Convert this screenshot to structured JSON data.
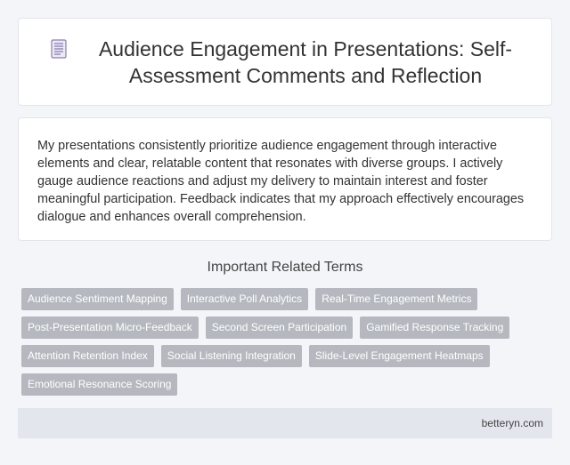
{
  "header": {
    "icon": "document-icon",
    "title": "Audience Engagement in Presentations: Self-Assessment Comments and Reflection"
  },
  "body": {
    "text": "My presentations consistently prioritize audience engagement through interactive elements and clear, relatable content that resonates with diverse groups. I actively gauge audience reactions and adjust my delivery to maintain interest and foster meaningful participation. Feedback indicates that my approach effectively encourages dialogue and enhances overall comprehension."
  },
  "terms": {
    "heading": "Important Related Terms",
    "items": [
      "Audience Sentiment Mapping",
      "Interactive Poll Analytics",
      "Real-Time Engagement Metrics",
      "Post-Presentation Micro-Feedback",
      "Second Screen Participation",
      "Gamified Response Tracking",
      "Attention Retention Index",
      "Social Listening Integration",
      "Slide-Level Engagement Heatmaps",
      "Emotional Resonance Scoring"
    ]
  },
  "footer": {
    "site": "betteryn.com"
  },
  "colors": {
    "background": "#f4f5f9",
    "tag": "#b5b9bf",
    "footer": "#e4e6ee",
    "icon": "#8a7fb0"
  }
}
